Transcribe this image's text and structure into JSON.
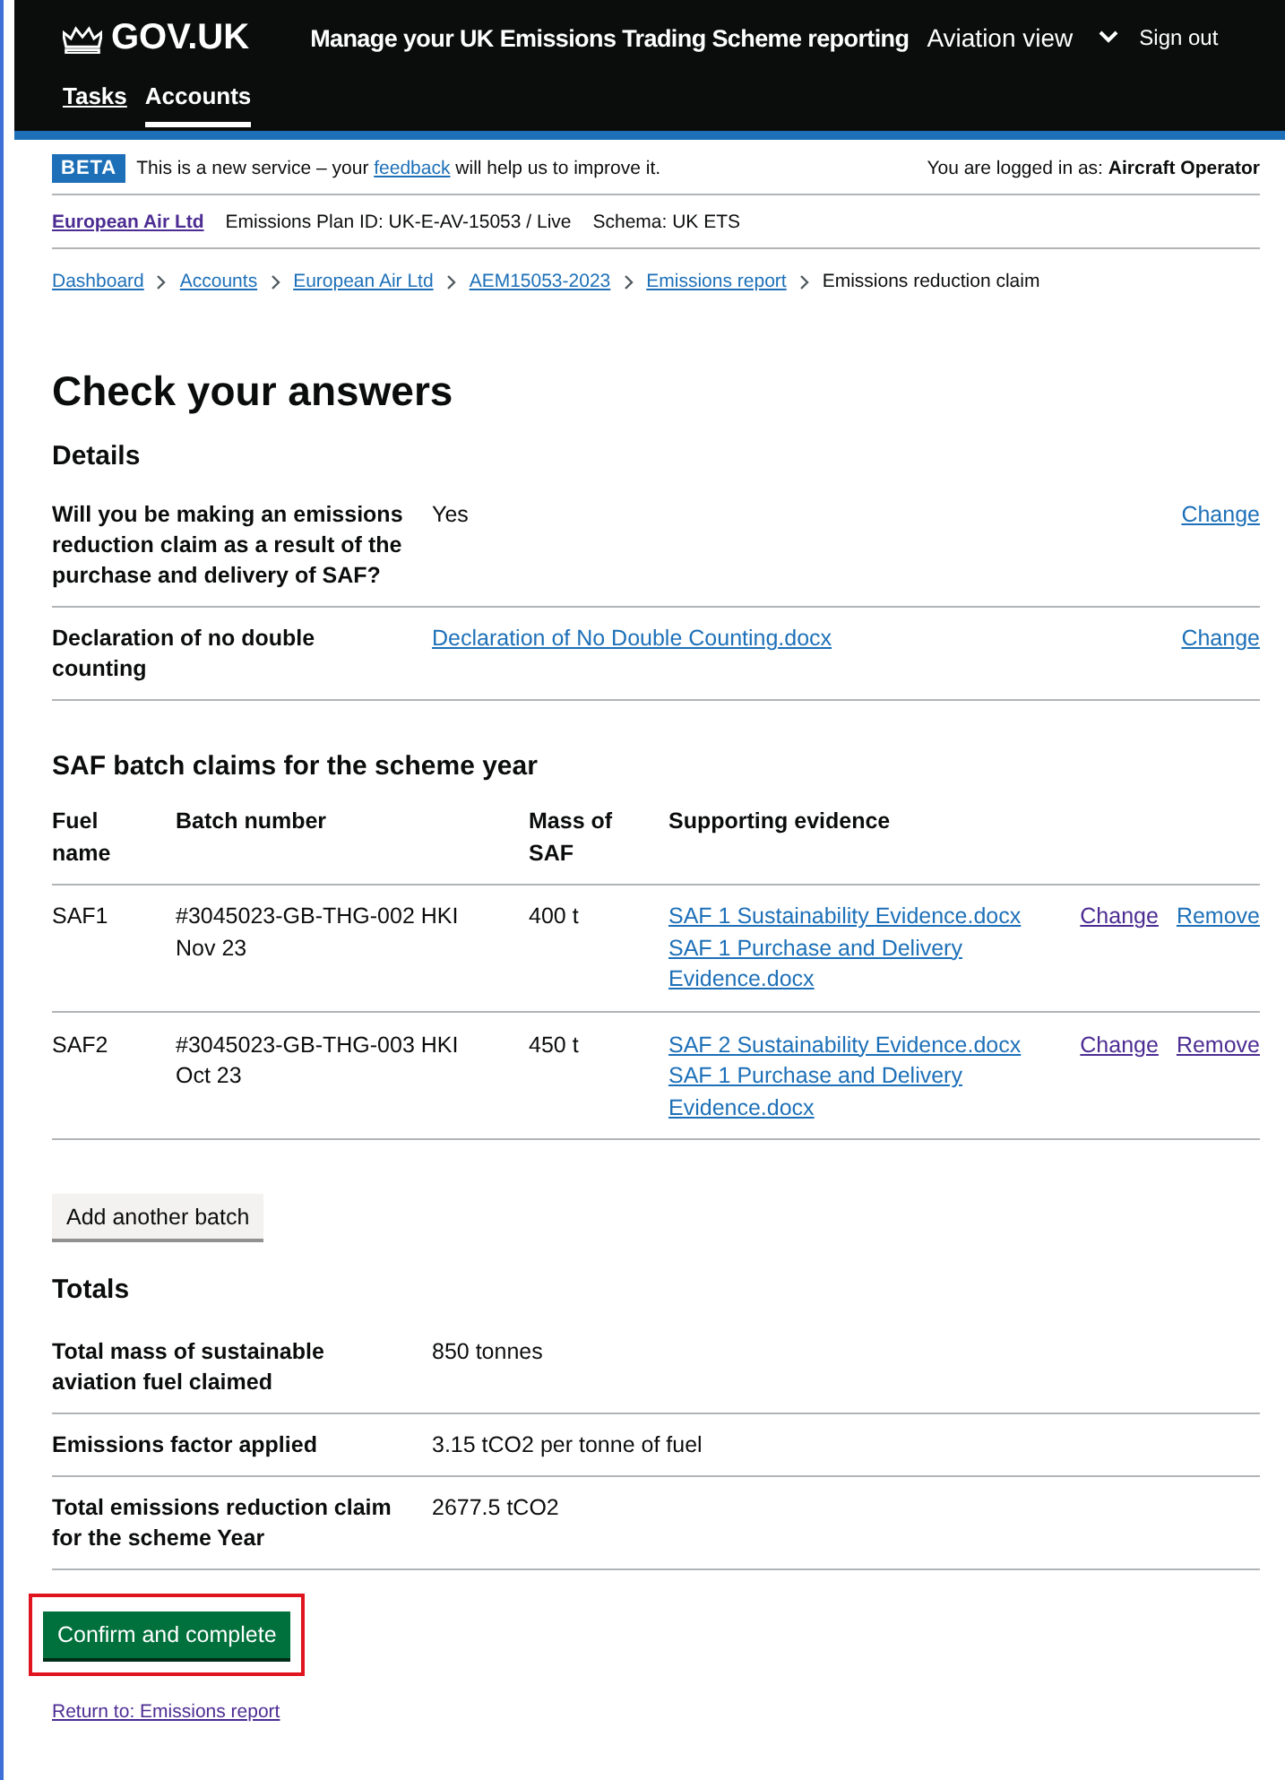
{
  "header": {
    "logo": "GOV.UK",
    "service": "Manage your UK Emissions Trading Scheme reporting",
    "view": "Aviation view",
    "sign_out": "Sign out",
    "nav": [
      {
        "label": "Tasks",
        "selected": false
      },
      {
        "label": "Accounts",
        "selected": true
      }
    ]
  },
  "phase_banner": {
    "tag": "BETA",
    "before": "This is a new service – your",
    "link": "feedback",
    "after": "will help us to improve it.",
    "logged_in": "You are logged in as: **Aircraft Operator**"
  },
  "account": {
    "name": {
      "text": "European Air Ltd",
      "visited": true
    },
    "plan_id": "Emissions Plan ID: UK-E-AV-15053 / Live",
    "schema": "Schema: UK ETS"
  },
  "breadcrumbs": [
    {
      "text": "Dashboard",
      "link": true
    },
    {
      "text": "Accounts",
      "link": true
    },
    {
      "text": "European Air Ltd",
      "link": true
    },
    {
      "text": "AEM15053-2023",
      "link": true
    },
    {
      "text": "Emissions report",
      "link": true
    },
    {
      "text": "Emissions reduction claim",
      "link": false
    }
  ],
  "title": "Check your answers",
  "details": {
    "heading": "Details",
    "rows": [
      {
        "key": "Will you be making an emissions reduction claim as a result of the purchase and delivery of SAF?",
        "value": {
          "kind": "text",
          "text": "Yes"
        },
        "action": {
          "text": "Change",
          "visited": false
        }
      },
      {
        "key": "Declaration of no double counting",
        "value": {
          "kind": "link",
          "text": "Declaration of No Double Counting.docx"
        },
        "action": {
          "text": "Change",
          "visited": false
        }
      }
    ]
  },
  "batches": {
    "heading": "SAF batch claims for the scheme year",
    "columns": [
      "Fuel name",
      "Batch number",
      "Mass of SAF",
      "Supporting evidence"
    ],
    "rows": [
      {
        "fuel": "SAF1",
        "batch": "#3045023-GB-THG-002 HKI Nov 23",
        "mass": "400 t",
        "evidence": [
          "SAF 1 Sustainability Evidence.docx",
          "SAF 1 Purchase and Delivery Evidence.docx"
        ],
        "actions": [
          {
            "text": "Change",
            "visited": true
          },
          {
            "text": "Remove",
            "visited": false
          }
        ]
      },
      {
        "fuel": "SAF2",
        "batch": "#3045023-GB-THG-003 HKI Oct 23",
        "mass": "450 t",
        "evidence": [
          "SAF 2 Sustainability Evidence.docx",
          "SAF 1 Purchase and Delivery Evidence.docx"
        ],
        "actions": [
          {
            "text": "Change",
            "visited": true
          },
          {
            "text": "Remove",
            "visited": true
          }
        ]
      }
    ]
  },
  "add_button": "Add another batch",
  "totals": {
    "heading": "Totals",
    "rows": [
      {
        "key": "Total mass of sustainable aviation fuel claimed",
        "value": "850 tonnes"
      },
      {
        "key": "Emissions factor applied",
        "value": "3.15 tCO2 per tonne of fuel"
      },
      {
        "key": "Total emissions reduction claim for the scheme Year",
        "value": "2677.5 tCO2"
      }
    ]
  },
  "confirm_button": {
    "label": "Confirm and complete",
    "highlighted": true
  },
  "return_link": {
    "text": "Return to: Emissions report",
    "visited": true
  }
}
